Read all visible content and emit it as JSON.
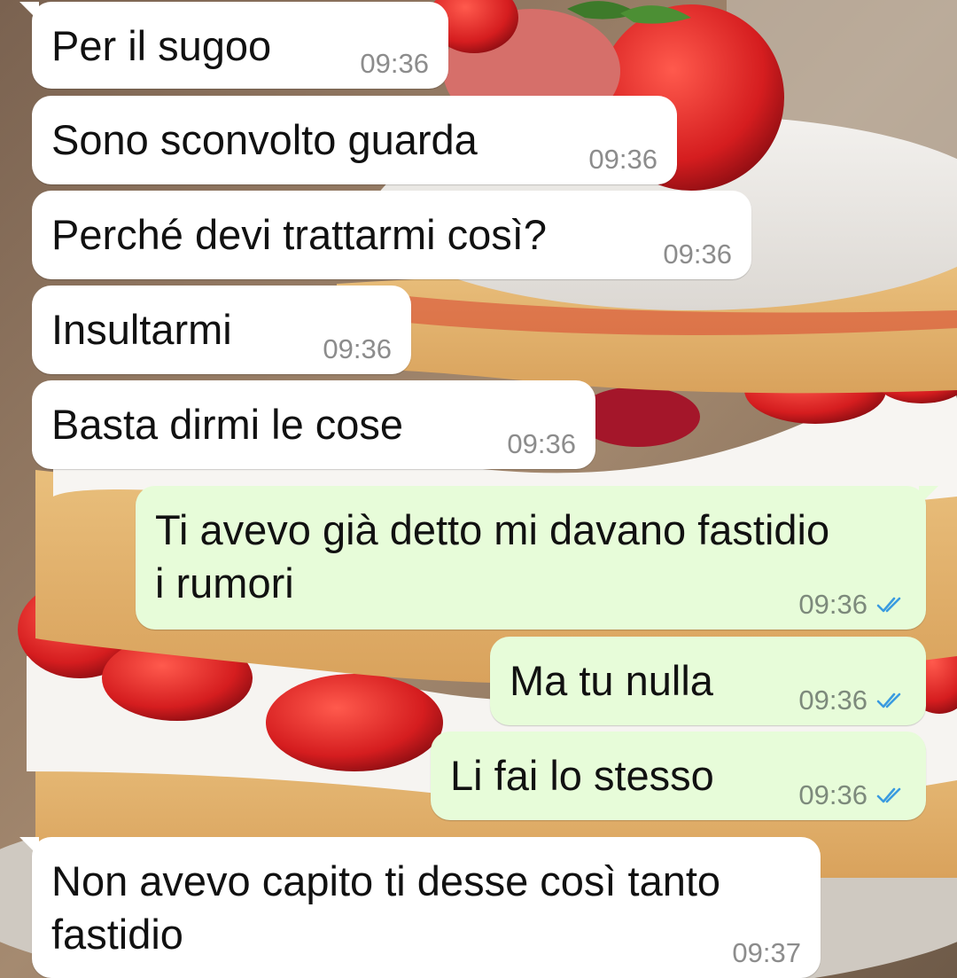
{
  "messages": [
    {
      "direction": "in",
      "text": "Per il sugoo",
      "time": "09:36"
    },
    {
      "direction": "in",
      "text": "Sono sconvolto guarda",
      "time": "09:36"
    },
    {
      "direction": "in",
      "text": "Perché devi trattarmi così?",
      "time": "09:36"
    },
    {
      "direction": "in",
      "text": "Insultarmi",
      "time": "09:36"
    },
    {
      "direction": "in",
      "text": "Basta dirmi le cose",
      "time": "09:36"
    },
    {
      "direction": "out",
      "line1": "Ti avevo già detto mi davano fastidio",
      "line2": "i rumori",
      "time": "09:36",
      "status": "read"
    },
    {
      "direction": "out",
      "text": "Ma tu nulla",
      "time": "09:36",
      "status": "read"
    },
    {
      "direction": "out",
      "text": "Li fai lo stesso",
      "time": "09:36",
      "status": "read"
    },
    {
      "direction": "in",
      "line1": "Non avevo capito ti desse così tanto",
      "line2": "fastidio",
      "time": "09:37"
    }
  ],
  "colors": {
    "incoming_bubble": "#ffffff",
    "outgoing_bubble": "#e7fcd9",
    "read_ticks": "#3a9be0",
    "timestamp": "#8c8c8c"
  },
  "icons": {
    "read_status": "double-check-icon"
  }
}
